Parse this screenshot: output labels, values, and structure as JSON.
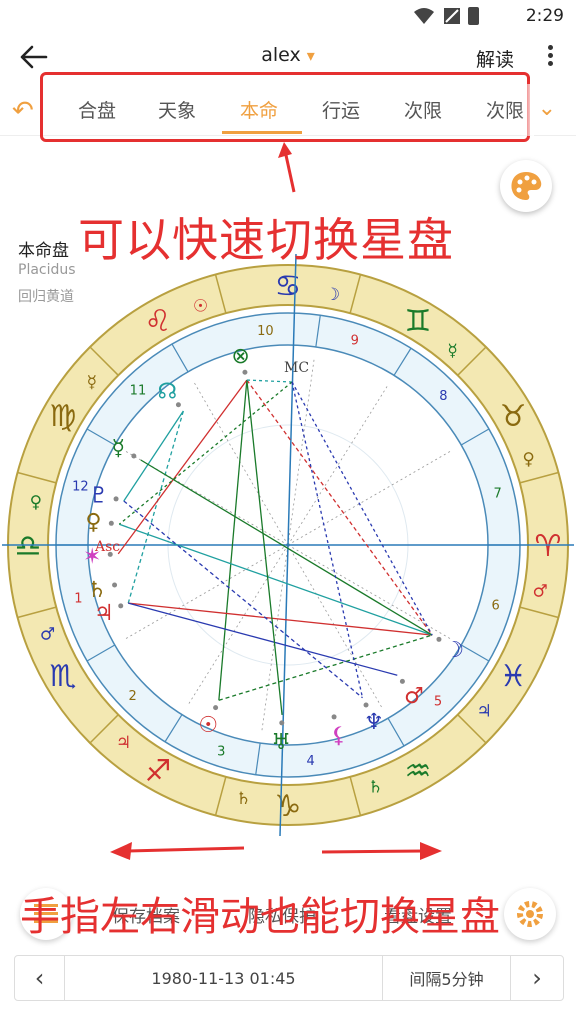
{
  "status": {
    "time": "2:29"
  },
  "app_bar": {
    "title": "alex",
    "title_caret": "▾",
    "read_label": "解读"
  },
  "tabs": [
    "合盘",
    "天象",
    "本命",
    "行运",
    "次限",
    "次限"
  ],
  "active_tab": 2,
  "chart_info": {
    "title": "本命盘",
    "house_system": "Placidus",
    "zodiac": "回归黄道"
  },
  "annotations": {
    "top": "可以快速切换星盘",
    "bottom": "手指左右滑动也能切换星盘"
  },
  "actions": {
    "save": "保存档案",
    "privacy": "隐私保护",
    "view": "看盘设置"
  },
  "bottom_bar": {
    "prev": "‹",
    "datetime": "1980-11-13 01:45",
    "interval": "间隔5分钟",
    "next": "›"
  },
  "wheel": {
    "signs": [
      "♈",
      "♉",
      "♊",
      "♋",
      "♌",
      "♍",
      "♎",
      "♏",
      "♐",
      "♑",
      "♒",
      "♓"
    ],
    "sign_colors": [
      "#d03030",
      "#8a6a10",
      "#1a7a2a",
      "#2a3ab0",
      "#d03030",
      "#8a6a10",
      "#1a7a2a",
      "#2a3ab0",
      "#d03030",
      "#8a6a10",
      "#1a7a2a",
      "#2a3ab0"
    ],
    "house_numbers": [
      "1",
      "2",
      "3",
      "4",
      "5",
      "6",
      "7",
      "8",
      "9",
      "10",
      "11",
      "12"
    ],
    "ruler_glyphs": [
      "♂",
      "♀",
      "☿",
      "☽",
      "☉",
      "☿",
      "♀",
      "♂",
      "♃",
      "♄",
      "♄",
      "♃"
    ],
    "angle_labels": {
      "asc": "Asc",
      "mc": "MC"
    },
    "planets": [
      {
        "glyph": "☽",
        "color": "#2a3ab0"
      },
      {
        "glyph": "♂",
        "color": "#d03030"
      },
      {
        "glyph": "♆",
        "color": "#2a3ab0"
      },
      {
        "glyph": "⚸",
        "color": "#d040c0"
      },
      {
        "glyph": "♅",
        "color": "#1a7a2a"
      },
      {
        "glyph": "☉",
        "color": "#d03030"
      },
      {
        "glyph": "♃",
        "color": "#d03030"
      },
      {
        "glyph": "♄",
        "color": "#8a6a10"
      },
      {
        "glyph": "✶",
        "color": "#d040c0"
      },
      {
        "glyph": "♀",
        "color": "#8a6a10"
      },
      {
        "glyph": "♇",
        "color": "#2a3ab0"
      },
      {
        "glyph": "☿",
        "color": "#1a7a2a"
      },
      {
        "glyph": "☊",
        "color": "#20a0a0"
      },
      {
        "glyph": "⊗",
        "color": "#1a7a2a"
      }
    ]
  }
}
